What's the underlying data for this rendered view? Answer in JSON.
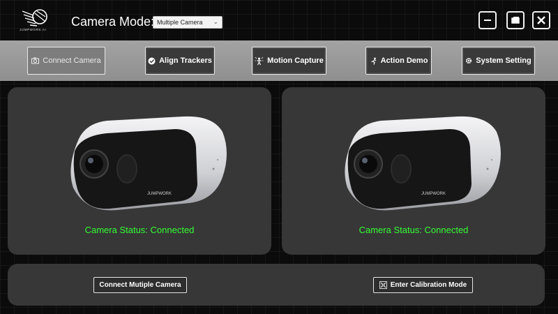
{
  "header": {
    "logo_text": "JUMPWORK.AI",
    "mode_label": "Camera Mode:",
    "mode_selected": "Multiple Camera"
  },
  "toolbar": {
    "connect_camera": "Connect Camera",
    "align_trackers": "Align Trackers",
    "motion_capture": "Motion Capture",
    "action_demo": "Action Demo",
    "system_setting": "System Setting"
  },
  "cameras": [
    {
      "status": "Camera Status: Connected",
      "brand": "JUMPWORK"
    },
    {
      "status": "Camera Status: Connected",
      "brand": "JUMPWORK"
    }
  ],
  "bottom": {
    "connect_multiple": "Connect Mutiple Camera",
    "calibration": "Enter Calibration Mode"
  },
  "colors": {
    "status_ok": "#33ff33",
    "toolbar_bg": "#999999",
    "panel_bg": "#373737"
  }
}
